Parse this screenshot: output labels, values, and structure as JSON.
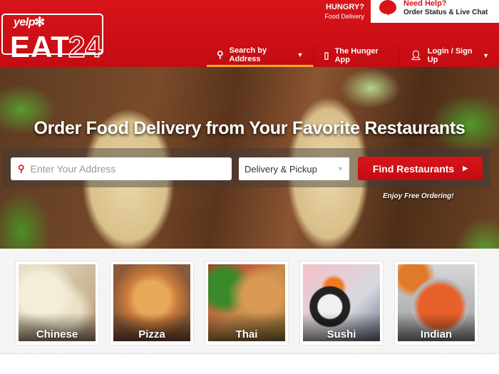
{
  "brand": {
    "yelp": "yelp",
    "eat": "EAT",
    "num": "24"
  },
  "header": {
    "hungry": "HUNGRY?",
    "food_delivery": "Food Delivery",
    "help_title": "Need Help?",
    "help_sub": "Order Status & Live Chat"
  },
  "nav": [
    {
      "label": "Search by Address",
      "icon": "map-pin-icon",
      "caret": true,
      "active": true
    },
    {
      "label": "The Hunger App",
      "icon": "phone-icon",
      "caret": false
    },
    {
      "label": "Login / Sign Up",
      "icon": "user-icon",
      "caret": true
    }
  ],
  "hero": {
    "title": "Order Food Delivery from Your Favorite Restaurants",
    "address_placeholder": "Enter Your Address",
    "address_value": "",
    "mode_selected": "Delivery & Pickup",
    "find_button": "Find Restaurants",
    "enjoy": "Enjoy Free Ordering!"
  },
  "categories": [
    {
      "label": "Chinese"
    },
    {
      "label": "Pizza"
    },
    {
      "label": "Thai"
    },
    {
      "label": "Sushi"
    },
    {
      "label": "Indian"
    }
  ],
  "colors": {
    "brand_red": "#d8141a",
    "accent_orange": "#f5a623"
  }
}
